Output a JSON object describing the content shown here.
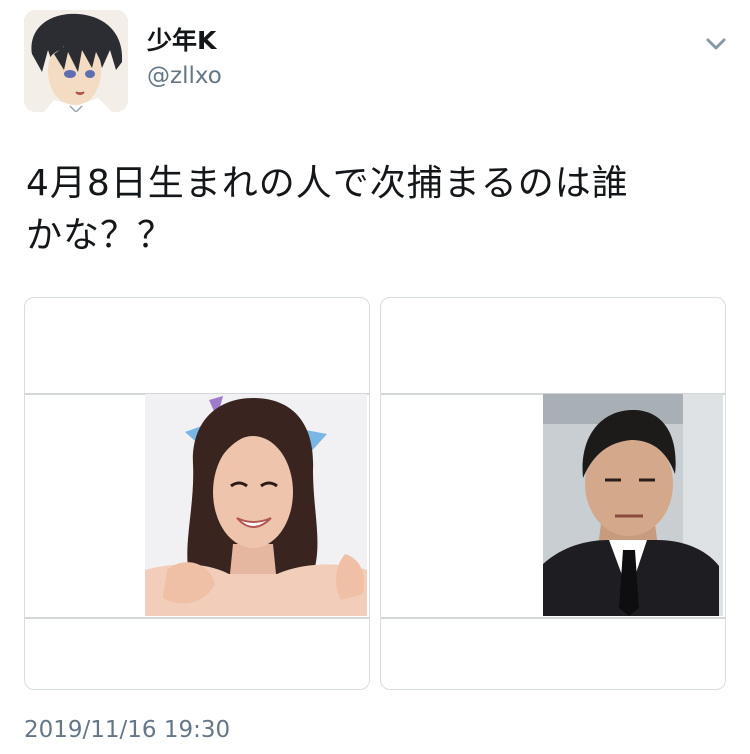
{
  "author": {
    "display_name": "少年K",
    "handle": "@zllxo",
    "avatar_icon": "anime-character-avatar"
  },
  "header": {
    "menu_icon": "chevron-down-icon"
  },
  "tweet": {
    "text_line1": "4月8日生まれの人で次捕まるのは誰",
    "text_line2": "かな？？",
    "timestamp": "2019/11/16 19:30"
  },
  "media": [
    {
      "description_icon": "woman-photo"
    },
    {
      "description_icon": "man-photo"
    }
  ],
  "colors": {
    "primary_text": "#14171a",
    "secondary_text": "#657786",
    "border": "#d8dde1"
  }
}
